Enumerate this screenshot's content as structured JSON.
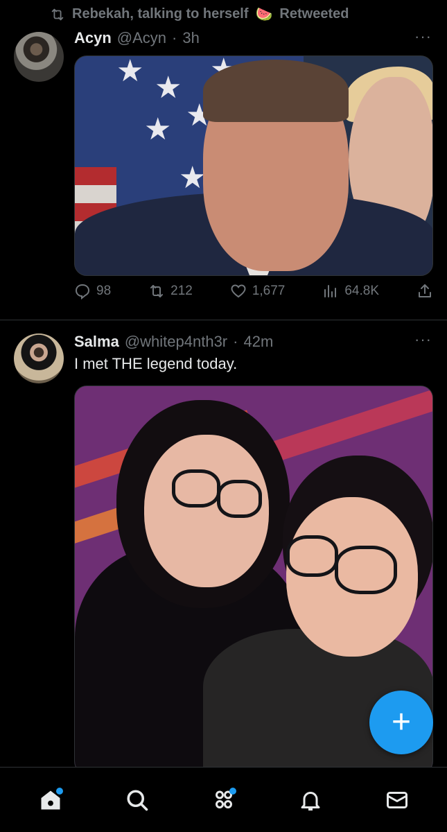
{
  "feed": {
    "tweets": [
      {
        "retweet_by": "Rebekah, talking to herself",
        "retweet_emoji": "🍉",
        "retweet_label": "Retweeted",
        "name": "Acyn",
        "handle": "@Acyn",
        "separator": "·",
        "time": "3h",
        "more": "···",
        "media_alt": "photo",
        "stats": {
          "replies": "98",
          "retweets": "212",
          "likes": "1,677",
          "views": "64.8K"
        }
      },
      {
        "name": "Salma",
        "handle": "@whitep4nth3r",
        "separator": "·",
        "time": "42m",
        "more": "···",
        "text": "I met THE legend today.",
        "media_alt": "photo"
      }
    ]
  },
  "fab": {
    "label": "+"
  },
  "nav": {
    "items": [
      {
        "name": "home",
        "badge": true
      },
      {
        "name": "search",
        "badge": false
      },
      {
        "name": "communities",
        "badge": true
      },
      {
        "name": "notifications",
        "badge": false
      },
      {
        "name": "messages",
        "badge": false
      }
    ]
  },
  "colors": {
    "accent": "#1d9bf0",
    "muted": "#71767b",
    "text": "#e7e9ea",
    "background": "#000000"
  }
}
